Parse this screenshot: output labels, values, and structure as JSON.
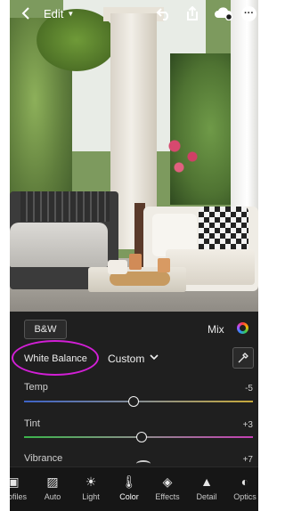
{
  "topbar": {
    "back_icon": "chevron-left-icon",
    "edit_label": "Edit",
    "undo_icon": "undo-icon",
    "share_icon": "share-icon",
    "cloud_icon": "cloud-sync-icon",
    "more_icon": "more-icon",
    "more_glyph": "···"
  },
  "panel": {
    "bw_label": "B&W",
    "mix_label": "Mix",
    "mix_icon": "color-wheel-icon",
    "white_balance_label": "White Balance",
    "white_balance_value": "Custom",
    "eyedropper_icon": "eyedropper-icon",
    "sliders": [
      {
        "label": "Temp",
        "value": "-5"
      },
      {
        "label": "Tint",
        "value": "+3"
      },
      {
        "label": "Vibrance",
        "value": "+7"
      }
    ]
  },
  "toolbar": {
    "items": [
      {
        "label": "Profiles",
        "icon": "profiles-icon"
      },
      {
        "label": "Auto",
        "icon": "auto-icon"
      },
      {
        "label": "Light",
        "icon": "light-icon"
      },
      {
        "label": "Color",
        "icon": "thermometer-icon"
      },
      {
        "label": "Effects",
        "icon": "effects-icon"
      },
      {
        "label": "Detail",
        "icon": "detail-icon"
      },
      {
        "label": "Optics",
        "icon": "optics-icon"
      }
    ]
  },
  "colors": {
    "accent_highlight": "#d21fd6",
    "panel_bg": "#1f1f1f"
  }
}
